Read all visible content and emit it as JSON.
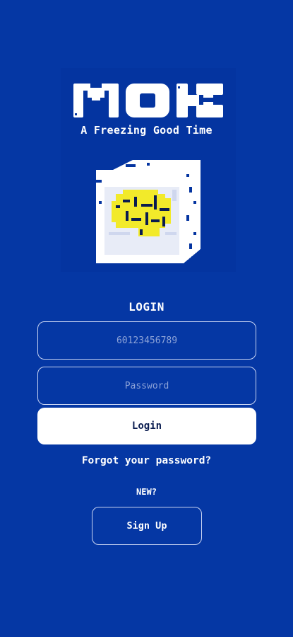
{
  "brand": {
    "logo_text": "MOK",
    "tagline": "A Freezing Good Time",
    "logo_icon": "pixel-ice-cube-icon"
  },
  "form": {
    "heading": "LOGIN",
    "phone_placeholder": "60123456789",
    "password_placeholder": "Password",
    "login_label": "Login",
    "forgot_label": "Forgot your password?"
  },
  "signup": {
    "new_label": "NEW?",
    "button_label": "Sign Up"
  },
  "colors": {
    "background": "#0537a4",
    "text": "#ffffff",
    "cube_fill": "#f2ea2a",
    "cube_shade": "#cfd7ee"
  }
}
